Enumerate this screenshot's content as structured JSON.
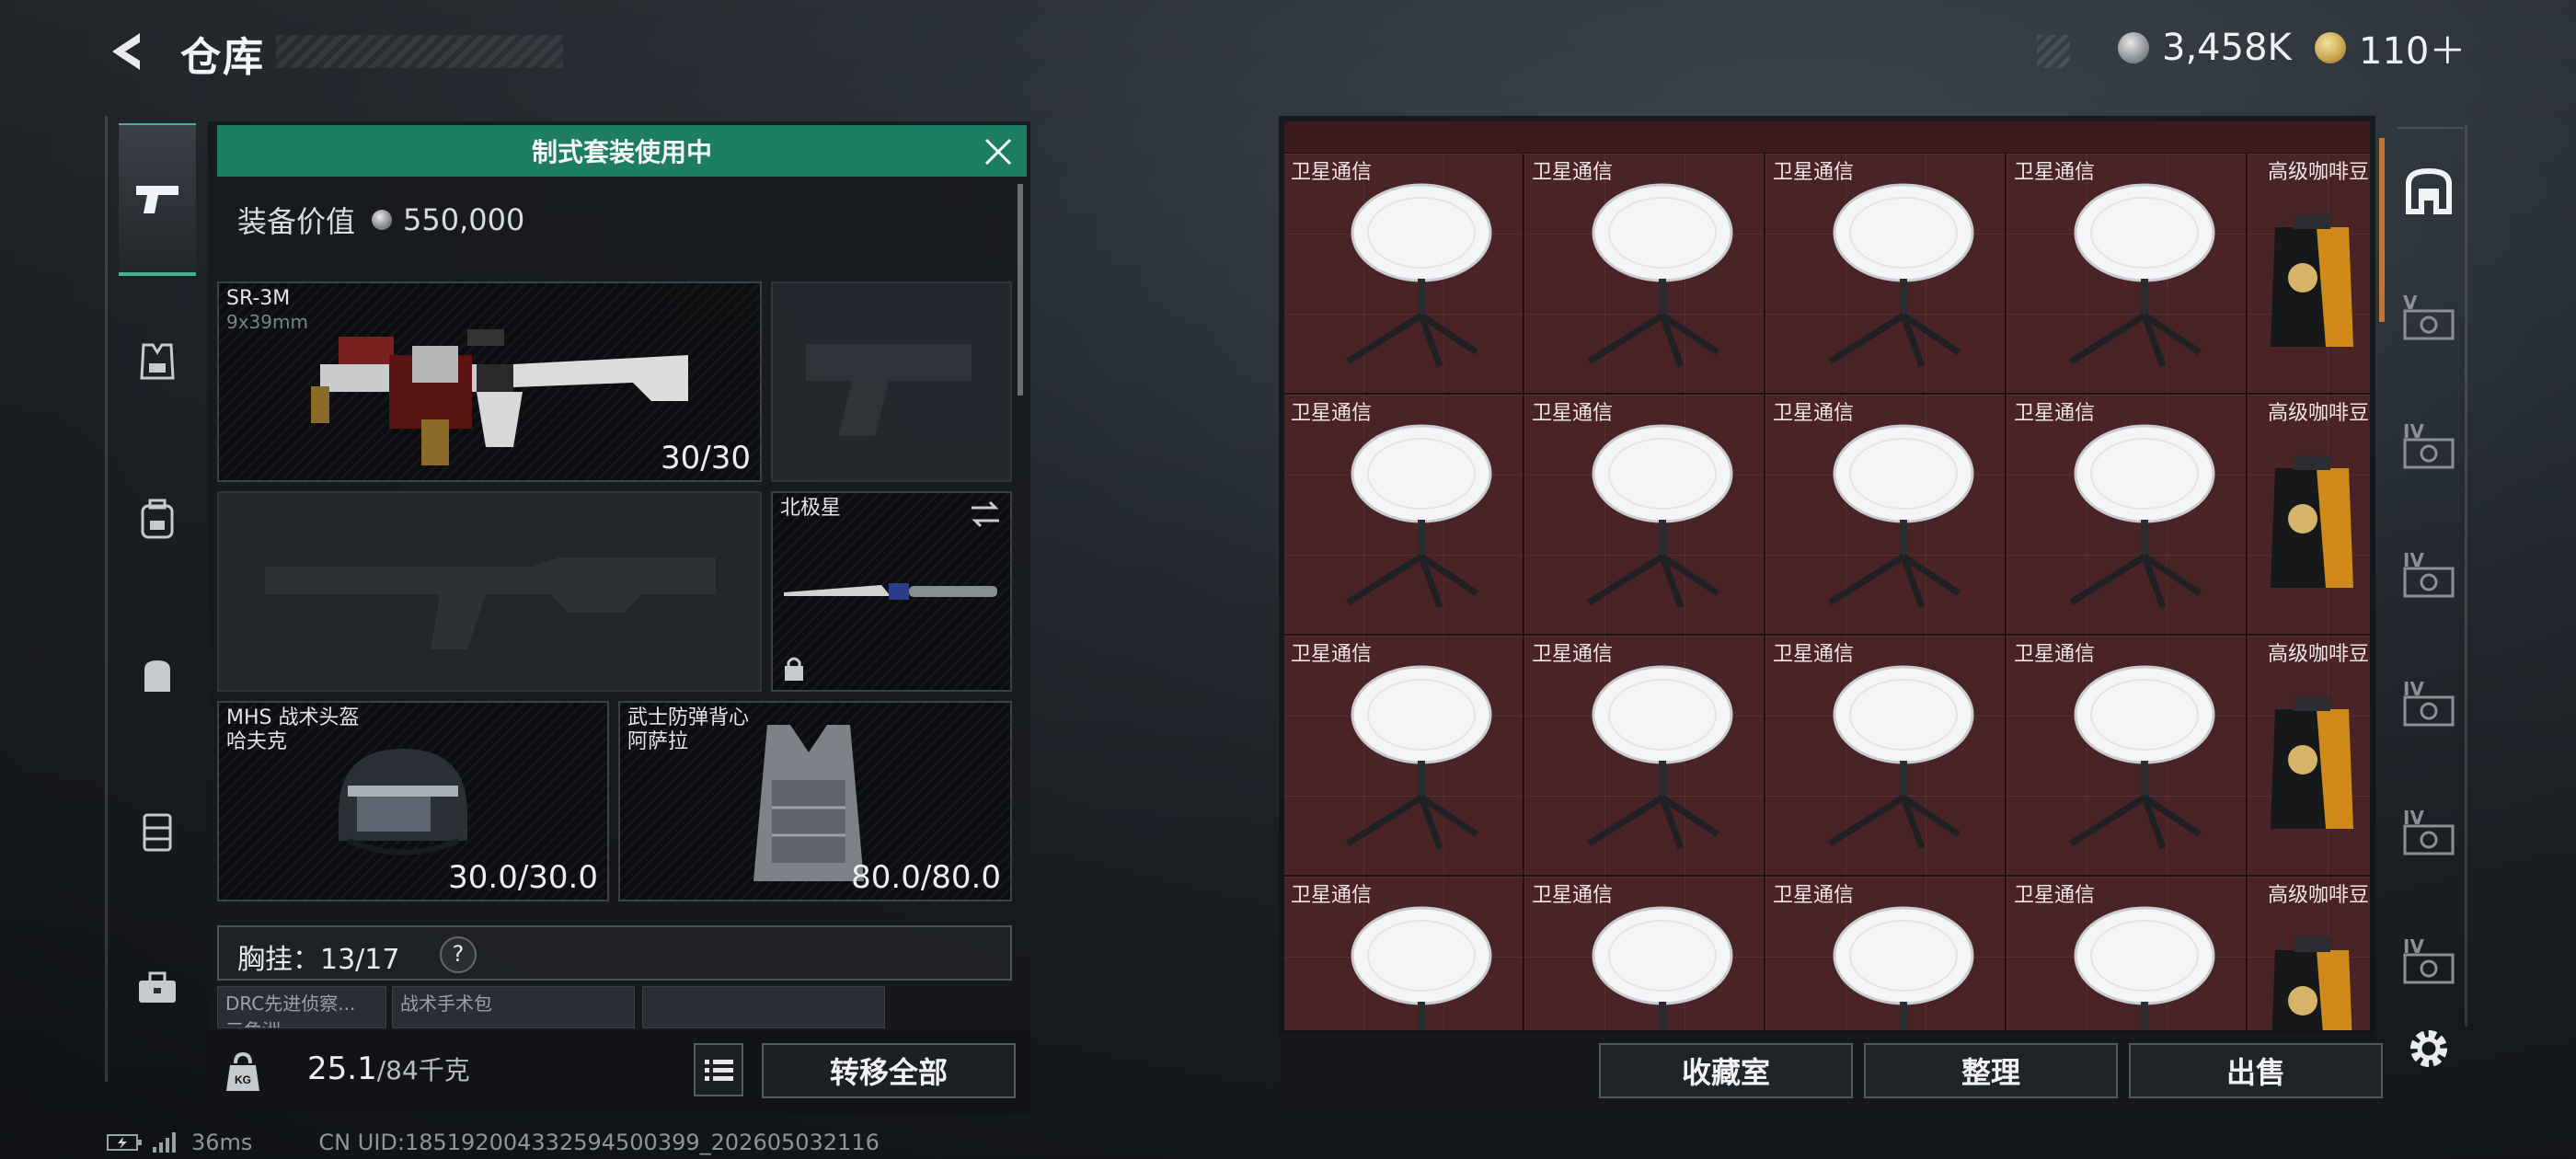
{
  "header": {
    "title": "仓库",
    "currency_silver": "3,458K",
    "currency_gold": "110＋"
  },
  "left_nav": {
    "items": [
      "weapon-icon",
      "armor-icon",
      "backpack-icon",
      "bag-icon",
      "chest-rig-icon",
      "case-icon"
    ],
    "active": "weapon-icon"
  },
  "loadout": {
    "banner": "制式套装使用中",
    "equip_value_label": "装备价值",
    "equip_value": "550,000",
    "primary": {
      "name": "SR-3M",
      "caliber": "9x39mm",
      "ammo": "30/30"
    },
    "melee": {
      "name": "北极星"
    },
    "helmet": {
      "line1": "MHS 战术头盔",
      "line2": "哈夫克",
      "durability": "30.0/30.0"
    },
    "armor": {
      "line1": "武士防弹背心",
      "line2": "阿萨拉",
      "durability": "80.0/80.0"
    },
    "chest_rig": {
      "label": "胸挂：13/17",
      "help": "?"
    },
    "chest_items": [
      "DRC先进侦察...",
      "战术手术包",
      ""
    ],
    "chest_subtext": "三角洲"
  },
  "footer_left": {
    "weight_value": "25.1",
    "weight_max": "/84千克",
    "transfer_label": "转移全部"
  },
  "status": {
    "ping": "36ms",
    "uid": "CN UID:18519200433259450039​9_202605032116"
  },
  "storage": {
    "columns": [
      "卫星通信",
      "卫星通信",
      "卫星通信",
      "卫星通信",
      "高级咖啡豆"
    ],
    "rows": 4,
    "buttons": [
      "收藏室",
      "整理",
      "出售"
    ]
  },
  "right_nav": {
    "tabs": [
      "home-icon",
      "V",
      "IV",
      "IV",
      "IV",
      "IV",
      "IV"
    ]
  },
  "colors": {
    "accent_green": "#1d7d62",
    "grid_red": "#4a2326",
    "scroll_orange": "#c0762e"
  }
}
